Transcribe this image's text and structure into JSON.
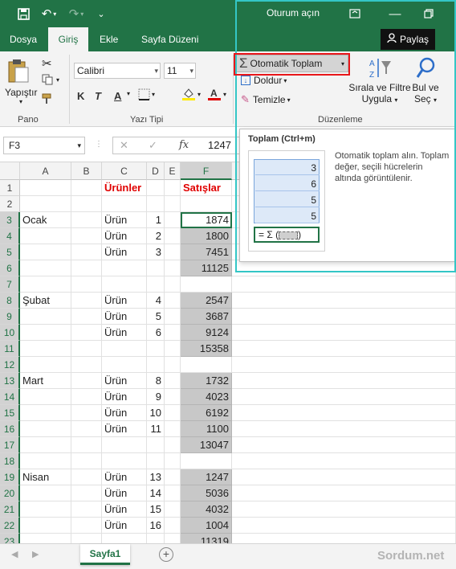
{
  "title_bar": {
    "signin": "Oturum açın"
  },
  "tabs": [
    {
      "label": "Dosya",
      "active": false
    },
    {
      "label": "Giriş",
      "active": true
    },
    {
      "label": "Ekle",
      "active": false
    },
    {
      "label": "Sayfa Düzeni",
      "active": false
    }
  ],
  "share_label": "Paylaş",
  "ribbon": {
    "paste_label": "Yapıştır",
    "clipboard_group": "Pano",
    "font_name": "Calibri",
    "font_size": "11",
    "font_group": "Yazı Tipi",
    "bold": "K",
    "italic": "T",
    "underline": "A",
    "autosum_label": "Otomatik Toplam",
    "fill_label": "Doldur",
    "clear_label": "Temizle",
    "sort_filter_label_1": "Sırala ve Filtre",
    "sort_filter_label_2": "Uygula",
    "find_label_1": "Bul ve",
    "find_label_2": "Seç",
    "editing_group": "Düzenleme"
  },
  "formula_bar": {
    "name_box": "F3",
    "fx": "fx",
    "value": "1247"
  },
  "columns": [
    "A",
    "B",
    "C",
    "D",
    "E",
    "F"
  ],
  "rows": [
    {
      "n": "1",
      "a": "",
      "c": "Ürünler",
      "d": "",
      "f": "Satışlar",
      "header": true
    },
    {
      "n": "2",
      "a": "",
      "c": "",
      "d": "",
      "f": ""
    },
    {
      "n": "3",
      "a": "Ocak",
      "c": "Ürün",
      "d": "1",
      "f": "1874"
    },
    {
      "n": "4",
      "a": "",
      "c": "Ürün",
      "d": "2",
      "f": "1800"
    },
    {
      "n": "5",
      "a": "",
      "c": "Ürün",
      "d": "3",
      "f": "7451"
    },
    {
      "n": "6",
      "a": "",
      "c": "",
      "d": "",
      "f": "11125"
    },
    {
      "n": "7",
      "a": "",
      "c": "",
      "d": "",
      "f": ""
    },
    {
      "n": "8",
      "a": "Şubat",
      "c": "Ürün",
      "d": "4",
      "f": "2547"
    },
    {
      "n": "9",
      "a": "",
      "c": "Ürün",
      "d": "5",
      "f": "3687"
    },
    {
      "n": "10",
      "a": "",
      "c": "Ürün",
      "d": "6",
      "f": "9124"
    },
    {
      "n": "11",
      "a": "",
      "c": "",
      "d": "",
      "f": "15358"
    },
    {
      "n": "12",
      "a": "",
      "c": "",
      "d": "",
      "f": ""
    },
    {
      "n": "13",
      "a": "Mart",
      "c": "Ürün",
      "d": "8",
      "f": "1732"
    },
    {
      "n": "14",
      "a": "",
      "c": "Ürün",
      "d": "9",
      "f": "4023"
    },
    {
      "n": "15",
      "a": "",
      "c": "Ürün",
      "d": "10",
      "f": "6192"
    },
    {
      "n": "16",
      "a": "",
      "c": "Ürün",
      "d": "11",
      "f": "1100"
    },
    {
      "n": "17",
      "a": "",
      "c": "",
      "d": "",
      "f": "13047"
    },
    {
      "n": "18",
      "a": "",
      "c": "",
      "d": "",
      "f": ""
    },
    {
      "n": "19",
      "a": "Nisan",
      "c": "Ürün",
      "d": "13",
      "f": "1247"
    },
    {
      "n": "20",
      "a": "",
      "c": "Ürün",
      "d": "14",
      "f": "5036"
    },
    {
      "n": "21",
      "a": "",
      "c": "Ürün",
      "d": "15",
      "f": "4032"
    },
    {
      "n": "22",
      "a": "",
      "c": "Ürün",
      "d": "16",
      "f": "1004"
    },
    {
      "n": "23",
      "a": "",
      "c": "",
      "d": "",
      "f": "11319"
    }
  ],
  "tooltip": {
    "title": "Toplam (Ctrl+m)",
    "description": "Otomatik toplam alın. Toplam değer, seçili hücrelerin altında görüntülenir.",
    "values": [
      "3",
      "6",
      "5",
      "5"
    ],
    "formula": "= Σ ("
  },
  "sheet_tab": "Sayfa1",
  "watermark": "Sordum.net",
  "colors": {
    "accent": "#217346",
    "highlight_red": "#e8161a",
    "highlight_cyan": "#34c6c6",
    "selection_gray": "#c8c8c8"
  }
}
